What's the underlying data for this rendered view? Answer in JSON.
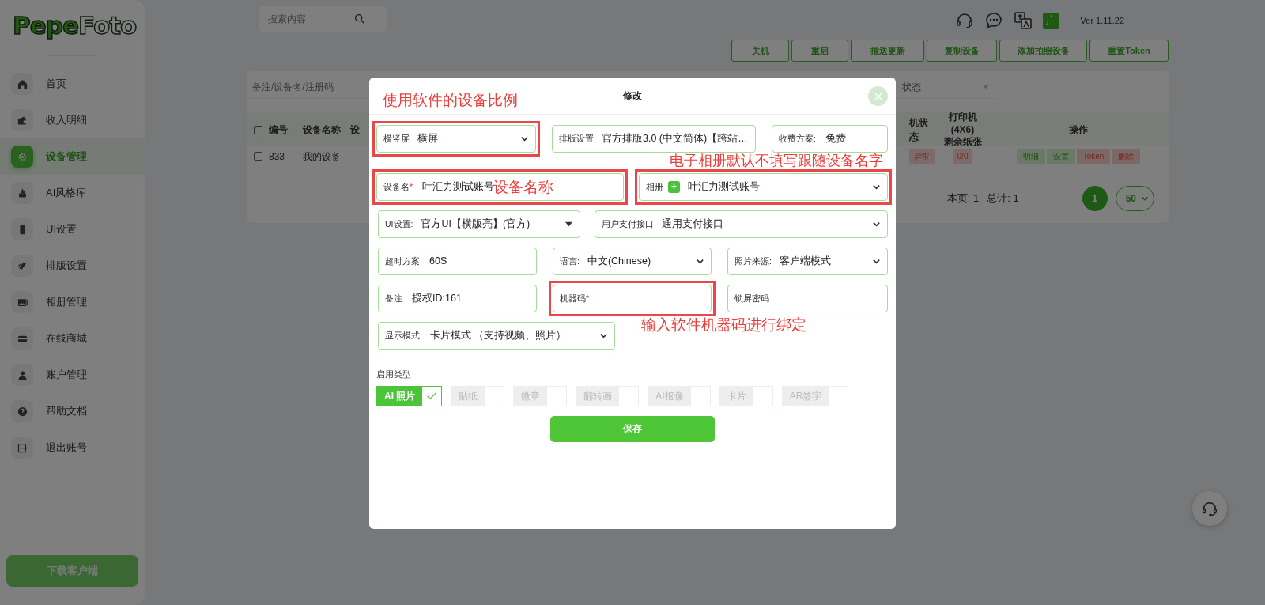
{
  "logo_parts": [
    "Pepe",
    "Foto"
  ],
  "sidebar": {
    "items": [
      {
        "label": "首页",
        "selected": false
      },
      {
        "label": "收入明细",
        "selected": false
      },
      {
        "label": "设备管理",
        "selected": true
      },
      {
        "label": "AI风格库",
        "selected": false
      },
      {
        "label": "UI设置",
        "selected": false
      },
      {
        "label": "排版设置",
        "selected": false
      },
      {
        "label": "相册管理",
        "selected": false
      },
      {
        "label": "在线商城",
        "selected": false
      },
      {
        "label": "账户管理",
        "selected": false
      },
      {
        "label": "帮助文档",
        "selected": false
      },
      {
        "label": "退出账号",
        "selected": false
      }
    ],
    "download_button": "下载客户端"
  },
  "header": {
    "search": {
      "placeholder": "搜索内容"
    },
    "avatar": "广",
    "version": "Ver 1.11.22"
  },
  "toolbar_buttons": [
    "关机",
    "重启",
    "推送更新",
    "复制设备",
    "添加拍照设备",
    "重置Token"
  ],
  "filters": {
    "search": {
      "placeholder": "备注/设备名/注册码"
    },
    "status": {
      "placeholder": "状态"
    }
  },
  "table": {
    "columns": [
      "编号",
      "设备名称",
      "设",
      "机状态",
      "打印机(4X6) 剩余纸张",
      "操作"
    ],
    "select_all": {
      "checked": false
    },
    "rows": [
      {
        "selected": false,
        "number": "833",
        "name": "我的设备",
        "status": "异常",
        "paper": "0/0",
        "actions": [
          {
            "label": "明细",
            "kind": "success"
          },
          {
            "label": "设置",
            "kind": "success"
          },
          {
            "label": "Token",
            "kind": "danger"
          },
          {
            "label": "删除",
            "kind": "danger"
          }
        ]
      }
    ]
  },
  "pagination": {
    "page_info": "本页: 1",
    "total_info": "总计: 1",
    "pages": [
      {
        "label": "1",
        "selected": true
      }
    ],
    "page_size": "50"
  },
  "modal": {
    "title": "修改",
    "rows": [
      [
        {
          "kind": "select",
          "label": "横竖屏",
          "value": "横屏",
          "highlighted": true,
          "note": "使用软件的设备比例"
        },
        {
          "kind": "dropdown",
          "label": "排版设置",
          "value": "官方排版3.0 (中文简体)【跨站…",
          "highlighted": false
        },
        {
          "kind": "input",
          "label": "收费方案:",
          "value": "免费",
          "highlighted": false
        }
      ],
      [
        {
          "kind": "input",
          "label": "设备名",
          "required_mark": "*",
          "value": "叶汇力测试账号",
          "highlighted": true,
          "note": "设备名称"
        },
        {
          "kind": "select",
          "label": "相册",
          "add_button": "+",
          "value": "叶汇力测试账号",
          "highlighted": true,
          "note": "电子相册默认不填写跟随设备名字"
        }
      ],
      [
        {
          "kind": "dropdown",
          "label": "UI设置:",
          "value": "官方UI【横版亮】(官方)",
          "highlighted": false
        },
        {
          "kind": "select",
          "label": "用户支付接口",
          "value": "通用支付接口",
          "highlighted": false
        }
      ],
      [
        {
          "kind": "input",
          "label": "超时方案",
          "value": "60S",
          "highlighted": false
        },
        {
          "kind": "select",
          "label": "语言:",
          "value": "中文(Chinese)",
          "highlighted": false
        },
        {
          "kind": "select",
          "label": "照片来源:",
          "value": "客户端模式",
          "highlighted": false
        }
      ],
      [
        {
          "kind": "input",
          "label": "备注",
          "value": "授权ID:161",
          "highlighted": false
        },
        {
          "kind": "input",
          "label": "机器码",
          "required_mark": "*",
          "highlighted": true,
          "note": "输入软件机器码进行绑定"
        },
        {
          "kind": "input",
          "label": "锁屏密码",
          "highlighted": false
        }
      ],
      [
        {
          "kind": "select",
          "label": "显示模式:",
          "value": "卡片模式 （支持视频、照片）",
          "highlighted": false
        }
      ]
    ],
    "types_label": "启用类型",
    "types": [
      {
        "label": "AI 照片",
        "checked": true
      },
      {
        "label": "贴纸",
        "checked": false
      },
      {
        "label": "微章",
        "checked": false
      },
      {
        "label": "翻转画",
        "checked": false
      },
      {
        "label": "AI抠像",
        "checked": false
      },
      {
        "label": "卡片",
        "checked": false
      },
      {
        "label": "AR签字",
        "checked": false
      }
    ],
    "save_button": "保存"
  }
}
